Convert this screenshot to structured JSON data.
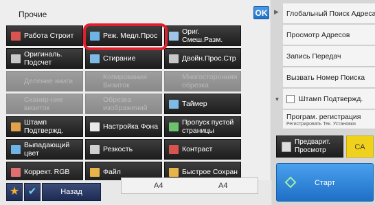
{
  "panel": {
    "title": "Прочие",
    "ok_label": "OK"
  },
  "buttons": [
    {
      "label": "Работа Строит",
      "enabled": true,
      "icon": "job-build-icon",
      "icolor": "#d9534f"
    },
    {
      "label": "Реж. Медл.Прос",
      "enabled": true,
      "icon": "slow-scan-icon",
      "icolor": "#6fb3e6"
    },
    {
      "label": "Ориг. Смеш.Разм.",
      "enabled": true,
      "icon": "mixed-size-icon",
      "icolor": "#9cc5e8"
    },
    {
      "label": "Оригиналь. Подсчет",
      "enabled": true,
      "icon": "original-count-icon",
      "icolor": "#c8c8c8"
    },
    {
      "label": "Стирание",
      "enabled": true,
      "icon": "erase-icon",
      "icolor": "#7fb9e6"
    },
    {
      "label": "Двойн.Прос.Стр",
      "enabled": true,
      "icon": "dual-page-icon",
      "icolor": "#c8c8c8"
    },
    {
      "label": "Деление книги",
      "enabled": false,
      "icon": "book-divide-icon",
      "icolor": "#888"
    },
    {
      "label": "Копирования Визиток",
      "enabled": false,
      "icon": "card-copy-icon",
      "icolor": "#888"
    },
    {
      "label": "Многосторонняя обрезка",
      "enabled": false,
      "icon": "multi-crop-icon",
      "icolor": "#888"
    },
    {
      "label": "Сканир-ние визиток",
      "enabled": false,
      "icon": "card-scan-icon",
      "icolor": "#888"
    },
    {
      "label": "Обрезка изображений",
      "enabled": false,
      "icon": "image-crop-icon",
      "icolor": "#888"
    },
    {
      "label": "Таймер",
      "enabled": true,
      "icon": "timer-icon",
      "icolor": "#7fb9e6"
    },
    {
      "label": "Штамп Подтвержд.",
      "enabled": true,
      "icon": "stamp-icon",
      "icolor": "#e2a14a"
    },
    {
      "label": "Настройка Фона",
      "enabled": true,
      "icon": "background-icon",
      "icolor": "#e8e8e8"
    },
    {
      "label": "Пропуск пустой страницы",
      "enabled": true,
      "icon": "blank-skip-icon",
      "icolor": "#6cc16c"
    },
    {
      "label": "Выпадающий цвет",
      "enabled": true,
      "icon": "color-dropout-icon",
      "icolor": "#6fb3e6"
    },
    {
      "label": "Резкость",
      "enabled": true,
      "icon": "sharpness-icon",
      "icolor": "#cfcfcf"
    },
    {
      "label": "Контраст",
      "enabled": true,
      "icon": "contrast-icon",
      "icolor": "#d9534f"
    },
    {
      "label": "Коррект. RGB",
      "enabled": true,
      "icon": "rgb-adjust-icon",
      "icolor": "#e26f6f"
    },
    {
      "label": "Файл",
      "enabled": true,
      "icon": "file-icon",
      "icolor": "#e8b44a"
    },
    {
      "label": "Быстрое Сохран",
      "enabled": true,
      "icon": "quick-save-icon",
      "icolor": "#e8b44a"
    }
  ],
  "bottom": {
    "back_label": "Назад",
    "paper_left": "A4",
    "paper_right": "A4"
  },
  "side": {
    "items": [
      {
        "label": "Глобальный Поиск Адреса"
      },
      {
        "label": "Просмотр Адресов"
      },
      {
        "label": "Запись Передач"
      },
      {
        "label": "Вызвать Номер Поиска"
      },
      {
        "label": "Штамп Подтвержд.",
        "checkbox": true
      },
      {
        "label": "Програм. регистрация",
        "sub": "Регистрировать Тек. Установки"
      }
    ],
    "preview_label": "Предварит. Просмотр",
    "ca_label": "CA",
    "start_label": "Старт"
  }
}
